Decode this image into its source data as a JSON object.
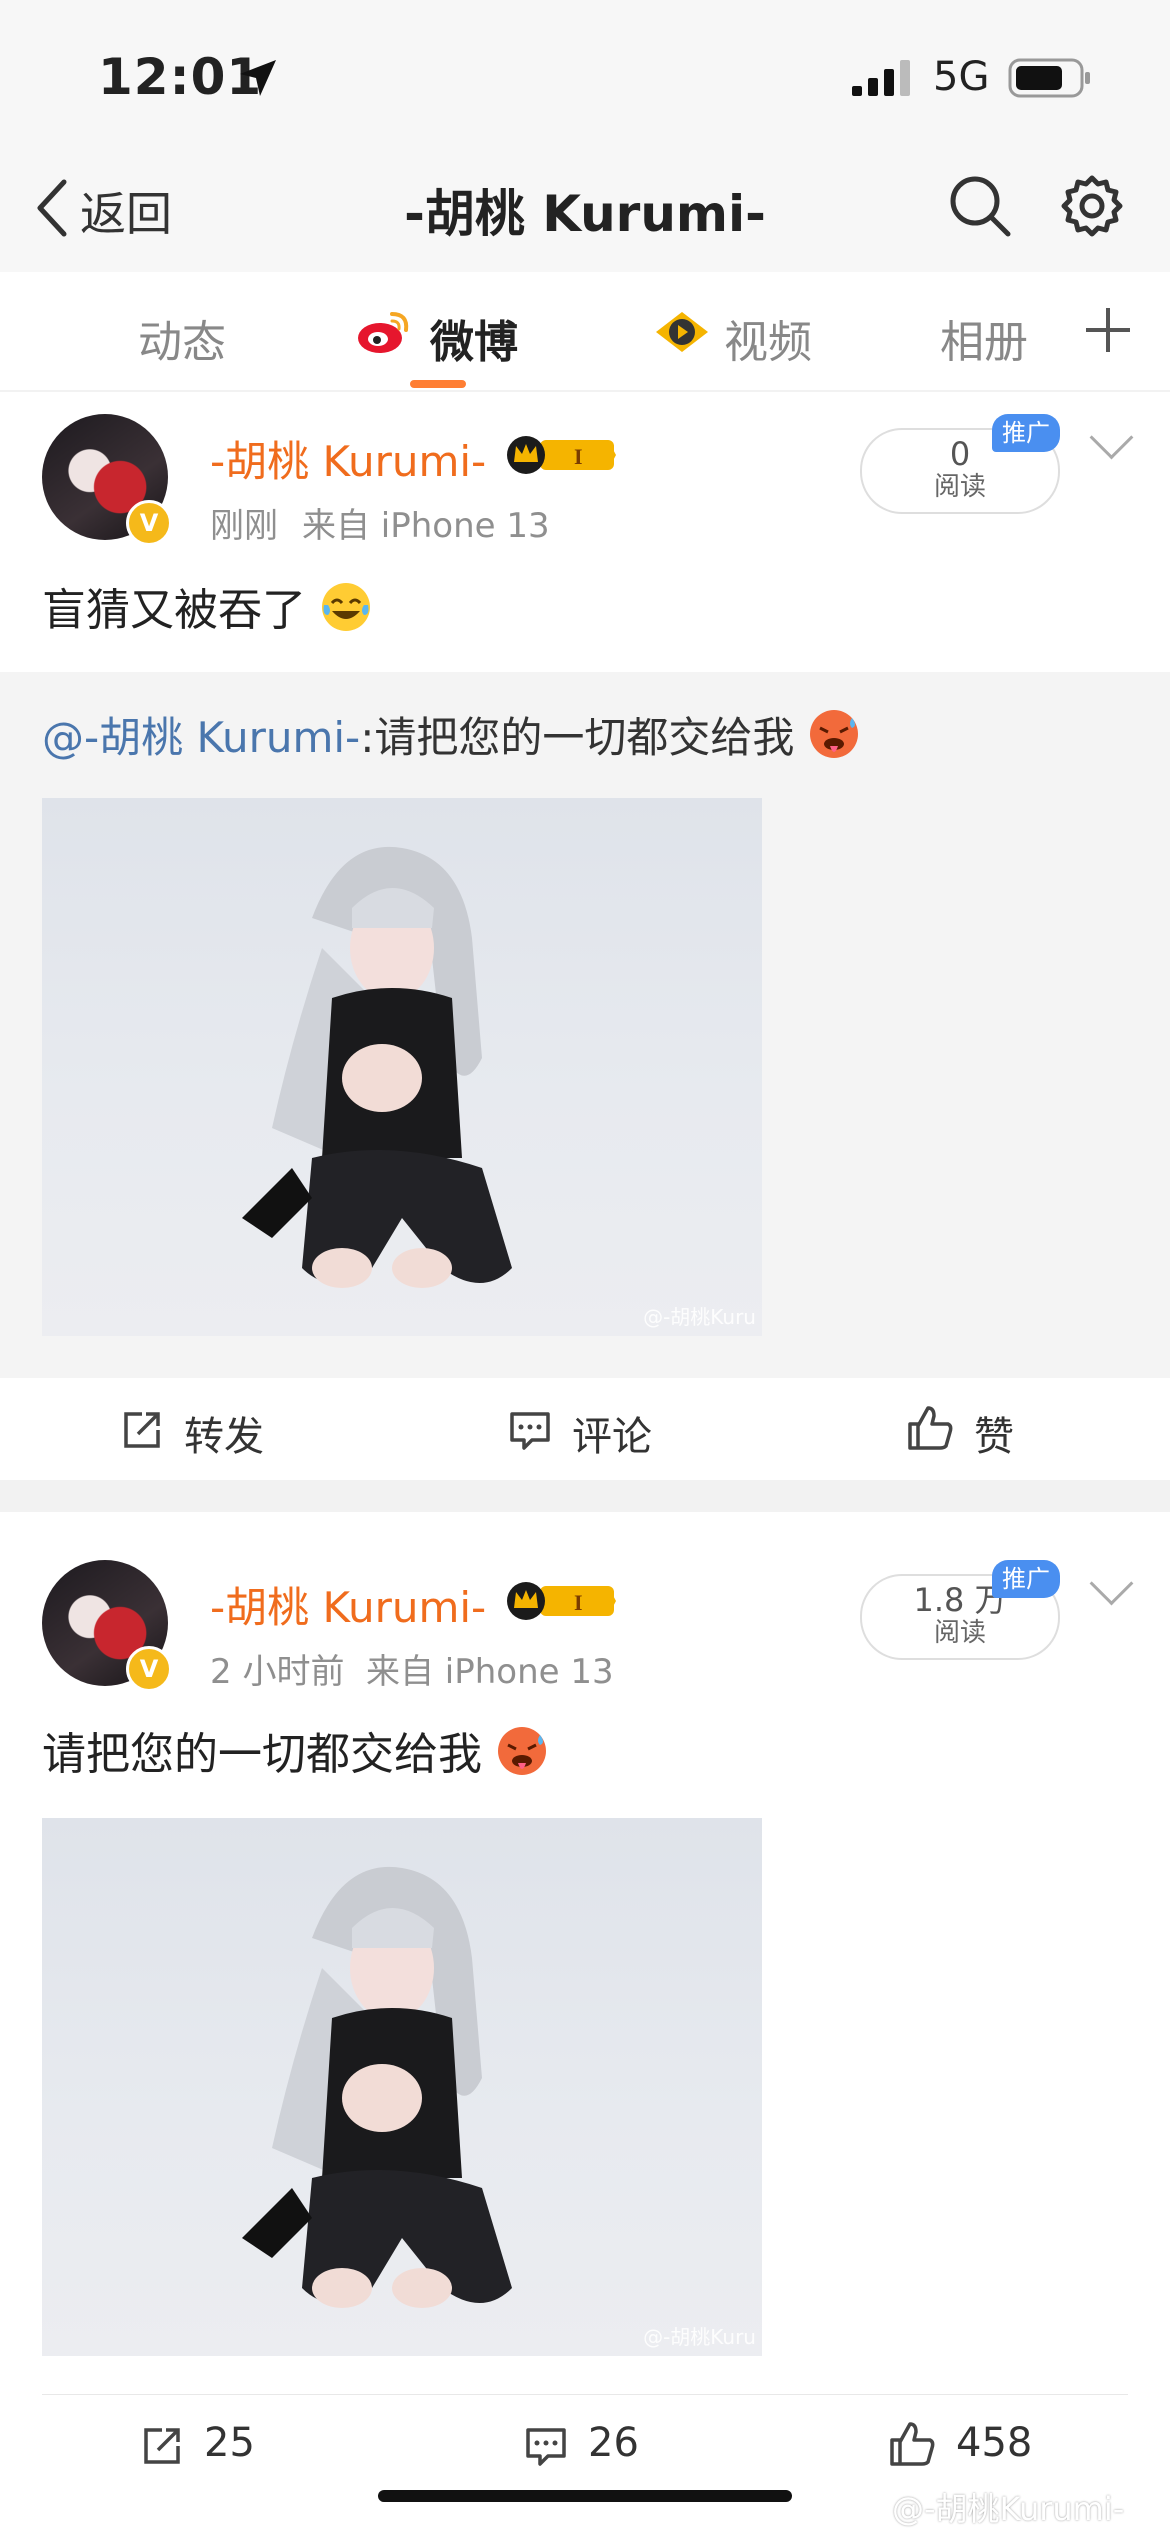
{
  "status_bar": {
    "time": "12:01",
    "network": "5G"
  },
  "nav": {
    "back_label": "返回",
    "title": "-胡桃 Kurumi-"
  },
  "tabs": [
    {
      "label": "动态",
      "active": false
    },
    {
      "label": "微博",
      "active": true
    },
    {
      "label": "视频",
      "active": false
    },
    {
      "label": "相册",
      "active": false
    }
  ],
  "colors": {
    "accent": "#ff7e33",
    "username": "#f06c1d",
    "mention": "#4a76ad",
    "promo": "#4a8ff0"
  },
  "posts": [
    {
      "username": "-胡桃 Kurumi-",
      "vip_level": "I",
      "time": "刚刚",
      "source": "来自 iPhone 13",
      "reads": "0",
      "reads_label": "阅读",
      "promo_label": "推广",
      "text": "盲猜又被吞了",
      "retweet": {
        "mention": "@-胡桃 Kurumi-",
        "text": ":请把您的一切都交给我",
        "watermark": "@-胡桃Kuru"
      },
      "actions": {
        "repost": "转发",
        "comment": "评论",
        "like": "赞"
      }
    },
    {
      "username": "-胡桃 Kurumi-",
      "vip_level": "I",
      "time": "2 小时前",
      "source": "来自 iPhone 13",
      "reads": "1.8 万",
      "reads_label": "阅读",
      "promo_label": "推广",
      "text": "请把您的一切都交给我",
      "image_watermark": "@-胡桃Kuru",
      "actions": {
        "repost": "25",
        "comment": "26",
        "like": "458"
      }
    }
  ],
  "footer_watermark": "@-胡桃Kurumi-"
}
